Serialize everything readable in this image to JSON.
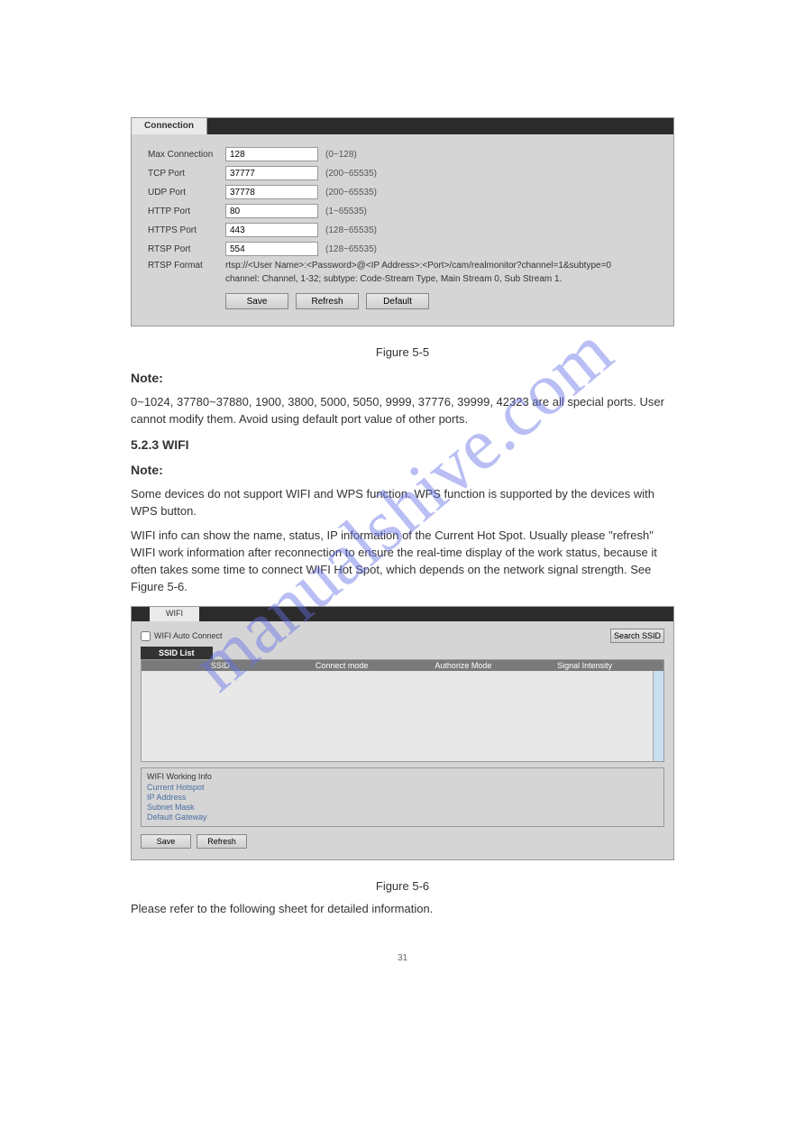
{
  "watermark": "manualshive.com",
  "connection": {
    "tab": "Connection",
    "rows": {
      "maxConn": {
        "label": "Max Connection",
        "value": "128",
        "range": "(0~128)"
      },
      "tcp": {
        "label": "TCP Port",
        "value": "37777",
        "range": "(200~65535)"
      },
      "udp": {
        "label": "UDP Port",
        "value": "37778",
        "range": "(200~65535)"
      },
      "http": {
        "label": "HTTP Port",
        "value": "80",
        "range": "(1~65535)"
      },
      "https": {
        "label": "HTTPS Port",
        "value": "443",
        "range": "(128~65535)"
      },
      "rtsp": {
        "label": "RTSP Port",
        "value": "554",
        "range": "(128~65535)"
      }
    },
    "rtspFormatLabel": "RTSP Format",
    "rtspFormatLine1": "rtsp://<User Name>:<Password>@<IP Address>:<Port>/cam/realmonitor?channel=1&subtype=0",
    "rtspFormatLine2": "channel: Channel, 1-32; subtype: Code-Stream Type, Main Stream 0, Sub Stream 1.",
    "buttons": {
      "save": "Save",
      "refresh": "Refresh",
      "default": "Default"
    }
  },
  "doc": {
    "fig5_5": "Figure 5-5",
    "noteTitle": "Note:",
    "noteBody": "0~1024, 37780~37880, 1900, 3800, 5000, 5050, 9999, 37776, 39999, 42323 are all special ports. User cannot modify them. Avoid using default port value of other ports.",
    "heading": "5.2.3 WIFI",
    "subheadNote": "Note:",
    "subheadBody": "Some devices do not support WIFI and WPS function. WPS function is supported by the devices with WPS button.",
    "subheadLine": "WIFI info can show the name, status, IP information of the Current Hot Spot. Usually please \"refresh\" WIFI work information after reconnection to ensure the real-time display of the work status, because it often takes some time to connect WIFI Hot Spot, which depends on the network signal strength. See Figure 5-6.",
    "fig5_6": "Figure 5-6",
    "parameters": "Please refer to the following sheet for detailed information."
  },
  "wifi": {
    "tab": "WIFI",
    "autoConnect": "WIFI Auto Connect",
    "searchBtn": "Search SSID",
    "ssidListTab": "SSID List",
    "columns": {
      "ssid": "SSID",
      "connectMode": "Connect mode",
      "authMode": "Authorize Mode",
      "signal": "Signal Intensity"
    },
    "info": {
      "title": "WIFI Working Info",
      "currentHotspot": "Current Hotspot",
      "ipAddress": "IP Address",
      "subnetMask": "Subnet Mask",
      "defaultGateway": "Default Gateway"
    },
    "buttons": {
      "save": "Save",
      "refresh": "Refresh"
    }
  },
  "pageNum": "31"
}
